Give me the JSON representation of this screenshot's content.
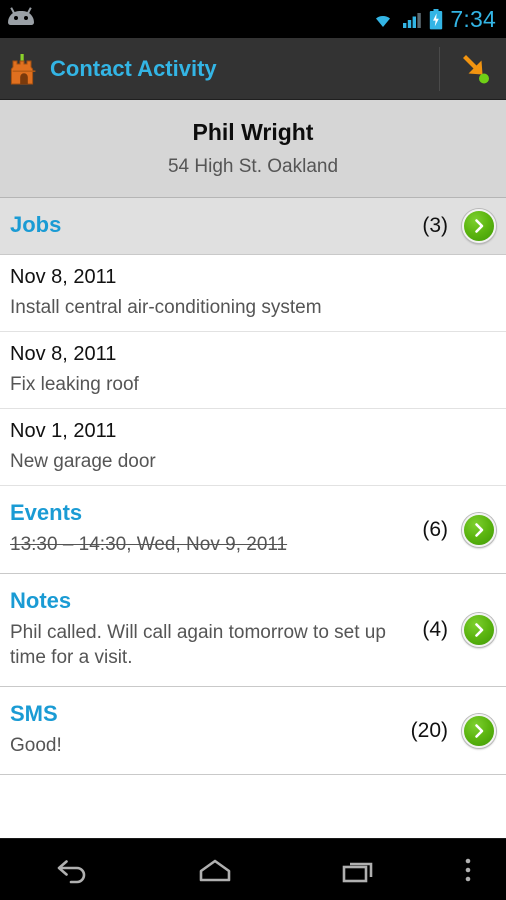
{
  "statusbar": {
    "notification_icon": "android-robot-icon",
    "wifi_icon": "wifi-icon",
    "signal_icon": "cellular-signal-icon",
    "battery_icon": "battery-charging-icon",
    "time": "7:34",
    "accent_color": "#33b5e5"
  },
  "actionbar": {
    "app_icon": "castle-tower-icon",
    "title": "Contact Activity",
    "action_icon": "arrow-down-right-icon",
    "action_badge": "green-dot-badge",
    "title_color": "#33b5e5",
    "background": "#333333"
  },
  "contact": {
    "name": "Phil Wright",
    "address": "54 High St.  Oakland"
  },
  "sections": [
    {
      "title": "Jobs",
      "count": "(3)",
      "go_icon": "chevron-right-icon",
      "shaded": true,
      "preview": "",
      "preview_struck": false,
      "items": [
        {
          "date": "Nov 8, 2011",
          "desc": "Install central air-conditioning system"
        },
        {
          "date": "Nov 8, 2011",
          "desc": "Fix leaking roof"
        },
        {
          "date": "Nov 1, 2011",
          "desc": "New garage door"
        }
      ]
    },
    {
      "title": "Events",
      "count": "(6)",
      "go_icon": "chevron-right-icon",
      "shaded": false,
      "preview": "13:30 – 14:30, Wed, Nov 9, 2011",
      "preview_struck": true,
      "items": []
    },
    {
      "title": "Notes",
      "count": "(4)",
      "go_icon": "chevron-right-icon",
      "shaded": false,
      "preview": "Phil called. Will call again tomorrow to set up time for a visit.",
      "preview_struck": false,
      "items": []
    },
    {
      "title": "SMS",
      "count": "(20)",
      "go_icon": "chevron-right-icon",
      "shaded": false,
      "preview": "Good!",
      "preview_struck": false,
      "items": []
    }
  ],
  "navbar": {
    "back_icon": "back-arrow-icon",
    "home_icon": "home-icon",
    "recents_icon": "recent-apps-icon",
    "menu_icon": "overflow-menu-icon"
  },
  "colors": {
    "section_title_blue": "#1a9bd4",
    "go_button_green": "#5cb510",
    "header_gray": "#d6d6d6"
  }
}
